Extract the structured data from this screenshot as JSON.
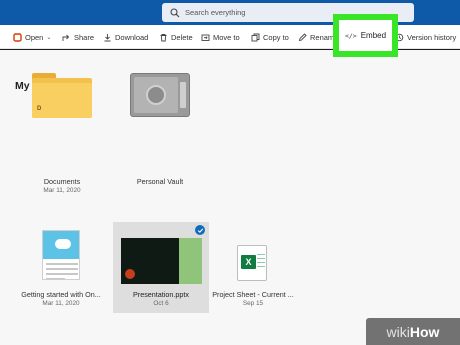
{
  "search": {
    "placeholder": "Search everything"
  },
  "toolbar": {
    "open": "Open",
    "share": "Share",
    "download": "Download",
    "delete": "Delete",
    "move_to": "Move to",
    "copy_to": "Copy to",
    "rename": "Renam",
    "embed": "Embed",
    "version_history": "Version history"
  },
  "section_title": "My files",
  "files": [
    {
      "name": "Documents",
      "date": "Mar 11, 2020",
      "icon": "folder-icon"
    },
    {
      "name": "Personal Vault",
      "date": "",
      "icon": "vault-icon"
    },
    {
      "name": "Getting started with On...",
      "date": "Mar 11, 2020",
      "icon": "document-thumbnail"
    },
    {
      "name": "Presentation.pptx",
      "date": "Oct 6",
      "icon": "pptx-thumbnail",
      "selected": true
    },
    {
      "name": "Project Sheet - Current ...",
      "date": "Sep 15",
      "icon": "excel-icon"
    }
  ],
  "watermark": {
    "prefix": "wiki",
    "suffix": "How"
  },
  "colors": {
    "brand": "#0f5aa8",
    "highlight": "#39e627",
    "excel": "#107c41",
    "select": "#0f6cbd"
  }
}
